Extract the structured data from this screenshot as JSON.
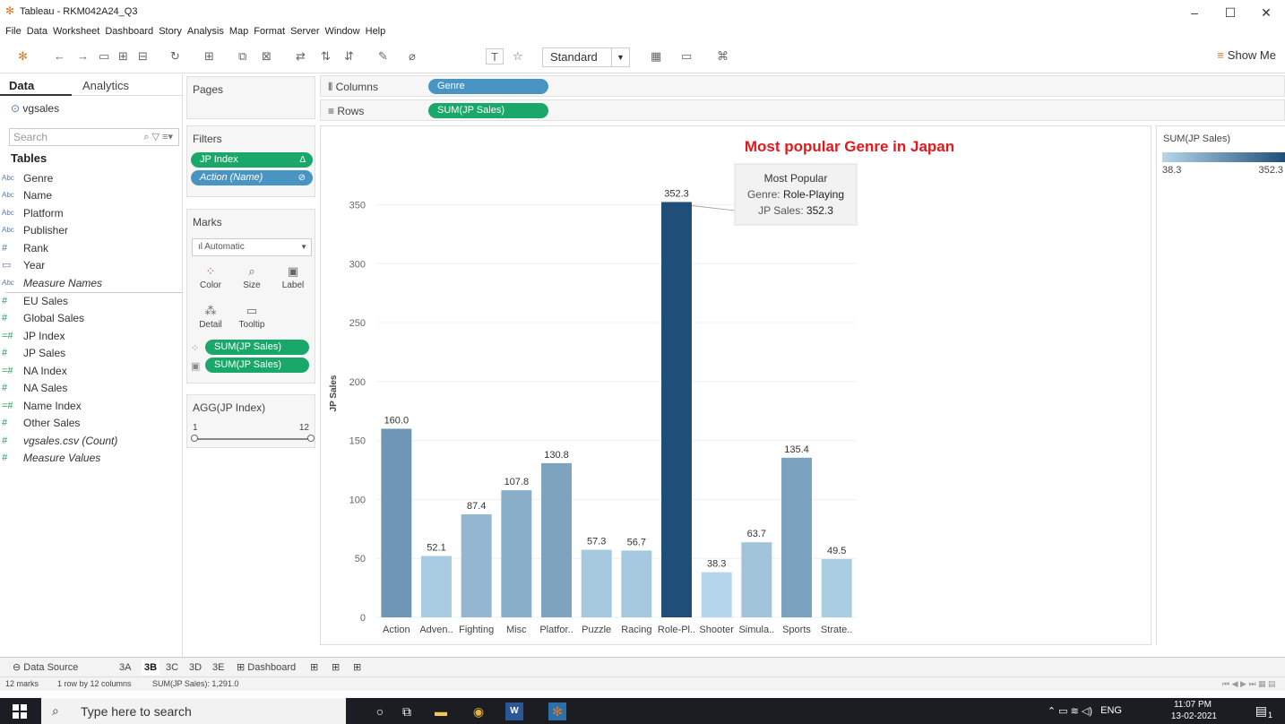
{
  "window": {
    "title": "Tableau - RKM042A24_Q3",
    "minimize": "–",
    "maximize": "☐",
    "close": "✕"
  },
  "menu": [
    "File",
    "Data",
    "Worksheet",
    "Dashboard",
    "Story",
    "Analysis",
    "Map",
    "Format",
    "Server",
    "Window",
    "Help"
  ],
  "toolbar": {
    "fit": "Standard",
    "show_me": "Show Me"
  },
  "data_pane": {
    "tab_data": "Data",
    "tab_analytics": "Analytics",
    "datasource": "vgsales",
    "search_placeholder": "Search",
    "tables_heading": "Tables",
    "dimensions": [
      {
        "type": "Abc",
        "name": "Genre"
      },
      {
        "type": "Abc",
        "name": "Name"
      },
      {
        "type": "Abc",
        "name": "Platform"
      },
      {
        "type": "Abc",
        "name": "Publisher"
      },
      {
        "type": "#",
        "name": "Rank"
      },
      {
        "type": "▭",
        "name": "Year"
      },
      {
        "type": "Abc",
        "name": "Measure Names"
      }
    ],
    "measures": [
      {
        "type": "#",
        "name": "EU Sales"
      },
      {
        "type": "#",
        "name": "Global Sales"
      },
      {
        "type": "=#",
        "name": "JP Index"
      },
      {
        "type": "#",
        "name": "JP Sales"
      },
      {
        "type": "=#",
        "name": "NA Index"
      },
      {
        "type": "#",
        "name": "NA Sales"
      },
      {
        "type": "=#",
        "name": "Name Index"
      },
      {
        "type": "#",
        "name": "Other Sales"
      },
      {
        "type": "#",
        "name": "vgsales.csv (Count)"
      },
      {
        "type": "#",
        "name": "Measure Values"
      }
    ]
  },
  "pages_label": "Pages",
  "filters": {
    "label": "Filters",
    "pills": [
      "JP Index",
      "Action (Name)"
    ]
  },
  "marks": {
    "label": "Marks",
    "type": "Automatic",
    "buttons": [
      "Color",
      "Size",
      "Label",
      "Detail",
      "Tooltip"
    ],
    "fields": [
      "SUM(JP Sales)",
      "SUM(JP Sales)"
    ]
  },
  "agg_card": {
    "label": "AGG(JP Index)",
    "min": "1",
    "max": "12"
  },
  "shelves": {
    "columns_label": "Columns",
    "rows_label": "Rows",
    "columns_pill": "Genre",
    "rows_pill": "SUM(JP Sales)"
  },
  "chart_data": {
    "type": "bar",
    "title": "Most popular Genre in Japan",
    "ylabel": "JP Sales",
    "ylim": [
      0,
      380
    ],
    "yticks": [
      0,
      50,
      100,
      150,
      200,
      250,
      300,
      350
    ],
    "categories": [
      "Action",
      "Adven..",
      "Fighting",
      "Misc",
      "Platfor..",
      "Puzzle",
      "Racing",
      "Role-Pl..",
      "Shooter",
      "Simula..",
      "Sports",
      "Strate.."
    ],
    "values": [
      160.0,
      52.1,
      87.4,
      107.8,
      130.8,
      57.3,
      56.7,
      352.3,
      38.3,
      63.7,
      135.4,
      49.5
    ],
    "value_labels": [
      "160.0",
      "52.1",
      "87.4",
      "107.8",
      "130.8",
      "57.3",
      "56.7",
      "352.3",
      "38.3",
      "63.7",
      "135.4",
      "49.5"
    ],
    "color_range": [
      "#b5d6ea",
      "#1f4e79"
    ],
    "annotation": {
      "line1": "Most Popular",
      "genre_label": "Genre:",
      "genre_value": "Role-Playing",
      "sales_label": "JP Sales:",
      "sales_value": "352.3"
    }
  },
  "legend": {
    "title": "SUM(JP Sales)",
    "min": "38.3",
    "max": "352.3"
  },
  "sheet_tabs": {
    "data_source": "Data Source",
    "tabs": [
      "3A",
      "3B",
      "3C",
      "3D",
      "3E",
      "Dashboard"
    ],
    "active": "3B"
  },
  "status": {
    "marks": "12 marks",
    "dims": "1 row by 12 columns",
    "sum": "SUM(JP Sales): 1,291.0"
  },
  "taskbar": {
    "search_placeholder": "Type here to search",
    "language": "ENG",
    "time": "11:07 PM",
    "date": "13-02-2021",
    "notif_count": "1"
  }
}
